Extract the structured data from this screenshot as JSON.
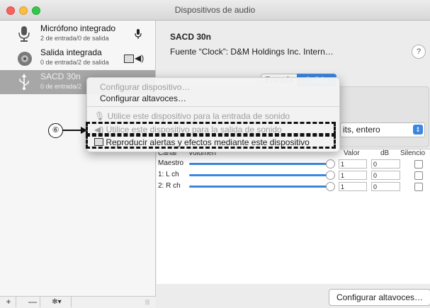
{
  "window": {
    "title": "Dispositivos de audio"
  },
  "sidebar": {
    "devices": [
      {
        "name": "Micrófono integrado",
        "sub": "2 de entrada/0 de salida"
      },
      {
        "name": "Salida integrada",
        "sub": "0 de entrada/2 de salida"
      },
      {
        "name": "SACD 30n",
        "sub": "0 de entrada/2"
      }
    ],
    "add_label": "+",
    "remove_label": "—",
    "gear_label": "✻▾"
  },
  "device_panel": {
    "title": "SACD 30n",
    "clock": "Fuente “Clock”:  D&M Holdings Inc. Intern…",
    "help": "?",
    "tabs": [
      "Entrada",
      "Salida"
    ],
    "format_value": "its, entero"
  },
  "table": {
    "headers": [
      "Canal",
      "Volumen",
      "Valor",
      "dB",
      "Silencio"
    ],
    "rows": [
      {
        "channel": "Maestro",
        "value": "1",
        "db": "0"
      },
      {
        "channel": "1: L ch",
        "value": "1",
        "db": "0"
      },
      {
        "channel": "2: R ch",
        "value": "1",
        "db": "0"
      }
    ]
  },
  "configure_button": "Configurar altavoces…",
  "context_menu": {
    "items": [
      {
        "label": "Configurar dispositivo…",
        "disabled": true
      },
      {
        "label": "Configurar altavoces…",
        "disabled": false
      },
      {
        "label": "Utilice este dispositivo para la entrada de sonido",
        "disabled": true
      },
      {
        "label": "Utilice este dispositivo para la salida de sonido",
        "disabled": true
      },
      {
        "label": "Reproducir alertas y efectos mediante este dispositivo",
        "disabled": false
      }
    ]
  },
  "callout": {
    "number": "⑥"
  },
  "colors": {
    "accent": "#3a87e0",
    "selected_row": "#a7a7a7"
  }
}
